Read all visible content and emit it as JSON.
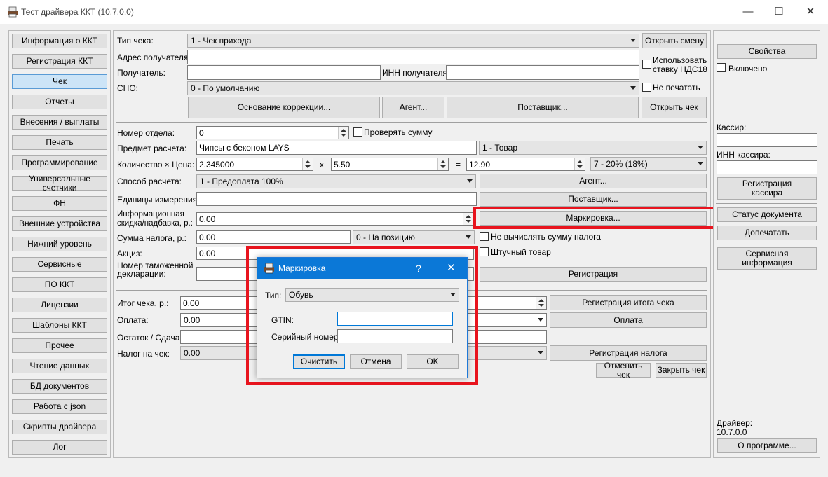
{
  "window": {
    "title": "Тест драйвера ККТ (10.7.0.0)",
    "min_icon": "minimize-icon",
    "max_icon": "maximize-icon",
    "close_icon": "close-icon"
  },
  "sidebar": {
    "items": [
      "Информация о ККТ",
      "Регистрация ККТ",
      "Чек",
      "Отчеты",
      "Внесения / выплаты",
      "Печать",
      "Программирование",
      "Универсальные счетчики",
      "ФН",
      "Внешние устройства",
      "Нижний уровень",
      "Сервисные",
      "ПО ККТ",
      "Лицензии",
      "Шаблоны ККТ",
      "Прочее",
      "Чтение данных",
      "БД документов",
      "Работа с json",
      "Скрипты драйвера",
      "Лог"
    ],
    "selected_index": 2
  },
  "receipt": {
    "type_label": "Тип чека:",
    "type_value": "1 - Чек прихода",
    "open_shift_button": "Открыть смену",
    "recipient_address_label": "Адрес получателя:",
    "recipient_address_value": "",
    "use_vat18_label": "Использовать ставку НДС18",
    "recipient_label": "Получатель:",
    "recipient_value": "",
    "recipient_inn_label": "ИНН получателя:",
    "recipient_inn_value": "",
    "sno_label": "СНО:",
    "sno_value": "0 - По умолчанию",
    "no_print_label": "Не печатать",
    "correction_basis_button": "Основание коррекции...",
    "agent_button": "Агент...",
    "supplier_button": "Поставщик...",
    "open_receipt_button": "Открыть чек"
  },
  "item": {
    "department_label": "Номер отдела:",
    "department_value": "0",
    "check_sum_label": "Проверять сумму",
    "subject_label": "Предмет расчета:",
    "subject_value": "Чипсы с беконом LAYS",
    "subject_type_value": "1 - Товар",
    "qty_price_label": "Количество × Цена:",
    "qty_value": "2.345000",
    "times_sign": "x",
    "price_value": "5.50",
    "equals_sign": "=",
    "total_value": "12.90",
    "vat_value": "7 - 20% (18%)",
    "payment_method_label": "Способ расчета:",
    "payment_method_value": "1 - Предоплата 100%",
    "agent_button": "Агент...",
    "units_label": "Единицы измерения:",
    "units_value": "",
    "supplier_button": "Поставщик...",
    "discount_label": "Информационная скидка/надбавка, р.:",
    "discount_value": "0.00",
    "marking_button": "Маркировка...",
    "tax_sum_label": "Сумма налога, р.:",
    "tax_sum_value": "0.00",
    "tax_mode_value": "0 - На позицию",
    "no_calc_tax_label": "Не вычислять сумму налога",
    "excise_label": "Акциз:",
    "excise_value": "0.00",
    "piece_goods_label": "Штучный товар",
    "customs_label": "Номер таможенной декларации:",
    "customs_value": "",
    "register_button": "Регистрация"
  },
  "totals": {
    "total_label": "Итог чека, р.:",
    "total_value": "0.00",
    "register_total_button": "Регистрация итога чека",
    "payment_label": "Оплата:",
    "payment_value": "0.00",
    "payment_button": "Оплата",
    "change_label": "Остаток / Сдача:",
    "change_value": "",
    "tax_label": "Налог на чек:",
    "tax_value": "0.00",
    "register_tax_button": "Регистрация налога",
    "cancel_receipt_button": "Отменить чек",
    "close_receipt_button": "Закрыть чек"
  },
  "right": {
    "properties_button": "Свойства",
    "enabled_label": "Включено",
    "cashier_label": "Кассир:",
    "cashier_value": "",
    "cashier_inn_label": "ИНН кассира:",
    "cashier_inn_value": "",
    "register_cashier_button": "Регистрация кассира",
    "doc_status_button": "Статус документа",
    "reprint_button": "Допечатать",
    "service_info_button": "Сервисная информация",
    "driver_label": "Драйвер:",
    "driver_version": "10.7.0.0",
    "about_button": "О программе..."
  },
  "dialog": {
    "title": "Маркировка",
    "help": "?",
    "close_icon": "close-icon",
    "type_label": "Тип:",
    "type_value": "Обувь",
    "gtin_label": "GTIN:",
    "gtin_value": "",
    "serial_label": "Серийный номер:",
    "serial_value": "",
    "clear_button": "Очистить",
    "cancel_button": "Отмена",
    "ok_button": "OK"
  },
  "colors": {
    "highlight": "#e8141e",
    "dialog_title": "#0b78d7",
    "selected_tab": "#cce4f7"
  }
}
